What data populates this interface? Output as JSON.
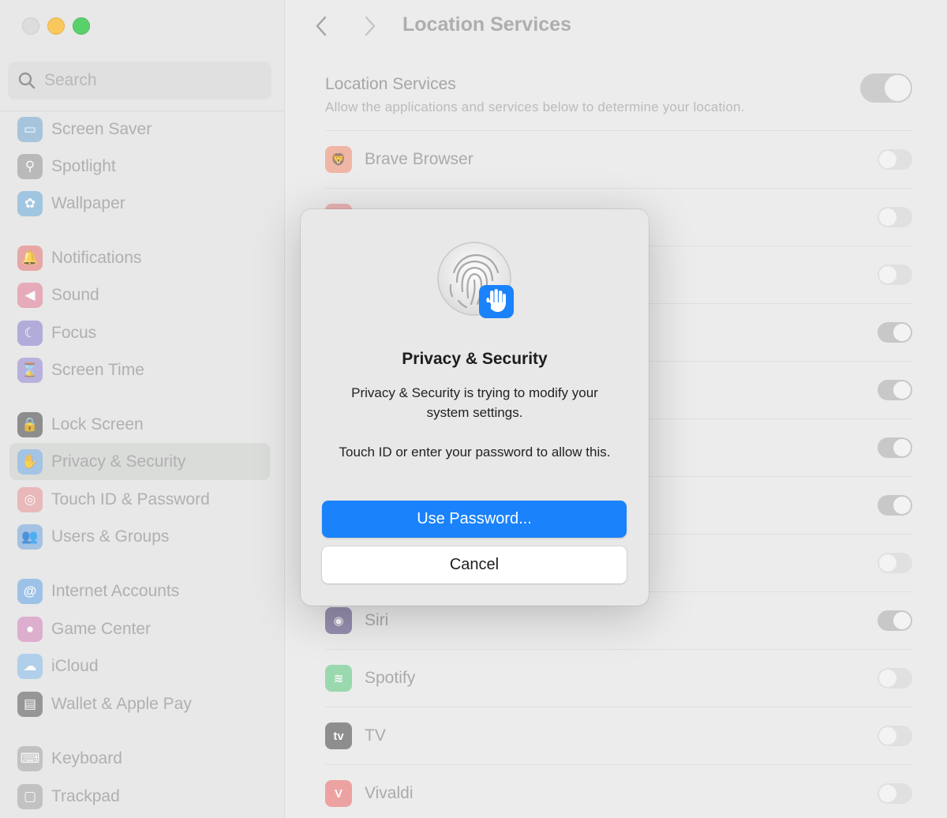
{
  "sidebar": {
    "search_placeholder": "Search",
    "items": [
      {
        "label": "Screen Saver",
        "icon": "screen-saver-icon",
        "color": "#8fb8d8"
      },
      {
        "label": "Spotlight",
        "icon": "spotlight-icon",
        "color": "#a9a9a9"
      },
      {
        "label": "Wallpaper",
        "icon": "wallpaper-icon",
        "color": "#87b9dc"
      },
      {
        "label": "Notifications",
        "icon": "notifications-icon",
        "color": "#e7908e"
      },
      {
        "label": "Sound",
        "icon": "sound-icon",
        "color": "#e595a8"
      },
      {
        "label": "Focus",
        "icon": "focus-icon",
        "color": "#9f97d6"
      },
      {
        "label": "Screen Time",
        "icon": "screen-time-icon",
        "color": "#a89ed8"
      },
      {
        "label": "Lock Screen",
        "icon": "lock-screen-icon",
        "color": "#6e6e6e"
      },
      {
        "label": "Privacy & Security",
        "icon": "privacy-hand-icon",
        "color": "#8bb7e2",
        "selected": true
      },
      {
        "label": "Touch ID & Password",
        "icon": "touch-id-icon",
        "color": "#e9a7a7"
      },
      {
        "label": "Users & Groups",
        "icon": "users-groups-icon",
        "color": "#8cb4e0"
      },
      {
        "label": "Internet Accounts",
        "icon": "internet-accounts-icon",
        "color": "#84b4e6"
      },
      {
        "label": "Game Center",
        "icon": "game-center-icon",
        "color": "#d99ac5"
      },
      {
        "label": "iCloud",
        "icon": "icloud-icon",
        "color": "#9cc6ea"
      },
      {
        "label": "Wallet & Apple Pay",
        "icon": "wallet-icon",
        "color": "#7a7a7a"
      },
      {
        "label": "Keyboard",
        "icon": "keyboard-icon",
        "color": "#b5b5b5"
      },
      {
        "label": "Trackpad",
        "icon": "trackpad-icon",
        "color": "#b5b5b5"
      }
    ]
  },
  "main": {
    "title": "Location Services",
    "location_services": {
      "title": "Location Services",
      "subtitle": "Allow the applications and services below to determine your location.",
      "enabled": true
    },
    "apps": [
      {
        "name": "Brave Browser",
        "icon": "brave-icon",
        "enabled": false
      },
      {
        "name": "",
        "icon": "app-icon",
        "enabled": false
      },
      {
        "name": "",
        "icon": "app-icon",
        "enabled": false
      },
      {
        "name": "",
        "icon": "app-icon",
        "enabled": true
      },
      {
        "name": "",
        "icon": "app-icon",
        "enabled": true
      },
      {
        "name": "",
        "icon": "app-icon",
        "enabled": true
      },
      {
        "name": "",
        "icon": "app-icon",
        "enabled": true
      },
      {
        "name": "",
        "icon": "app-icon",
        "enabled": false
      },
      {
        "name": "Siri",
        "icon": "siri-icon",
        "enabled": true
      },
      {
        "name": "Spotify",
        "icon": "spotify-icon",
        "enabled": false
      },
      {
        "name": "TV",
        "icon": "tv-icon",
        "enabled": false
      },
      {
        "name": "Vivaldi",
        "icon": "vivaldi-icon",
        "enabled": false
      }
    ]
  },
  "dialog": {
    "icon": "touch-id-privacy-icon",
    "title": "Privacy & Security",
    "message": "Privacy & Security is trying to modify your system settings.",
    "prompt": "Touch ID or enter your password to allow this.",
    "primary_label": "Use Password...",
    "secondary_label": "Cancel"
  },
  "colors": {
    "accent": "#1a82fb"
  }
}
